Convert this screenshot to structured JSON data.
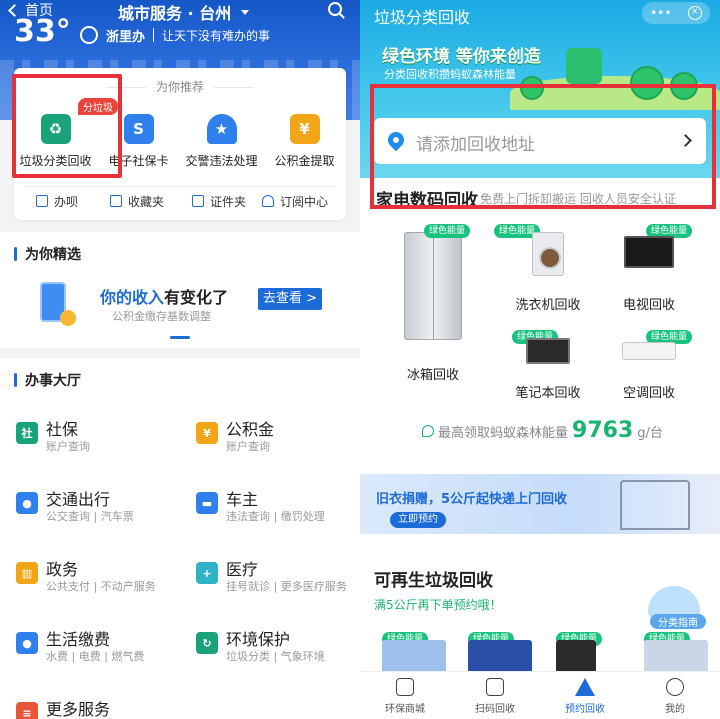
{
  "left": {
    "header": {
      "back_label": "首页",
      "title": "城市服务 · 台州",
      "temperature": "33°",
      "brand": "浙里办",
      "slogan": "让天下没有难办的事"
    },
    "recommend": {
      "title": "为你推荐",
      "badge": "分垃圾",
      "items": [
        {
          "label": "垃圾分类回收",
          "icon": "trash-bin-icon",
          "color": "#1aa37a"
        },
        {
          "label": "电子社保卡",
          "icon": "social-security-card-icon",
          "color": "#2f80ed"
        },
        {
          "label": "交警违法处理",
          "icon": "police-cap-icon",
          "color": "#2f80ed"
        },
        {
          "label": "公积金提取",
          "icon": "yuan-house-icon",
          "color": "#f2a516"
        }
      ],
      "tools": [
        {
          "label": "办呗",
          "icon": "ban-bei-icon"
        },
        {
          "label": "收藏夹",
          "icon": "folder-icon"
        },
        {
          "label": "证件夹",
          "icon": "id-card-icon"
        },
        {
          "label": "订阅中心",
          "icon": "bell-icon"
        }
      ]
    },
    "featured": {
      "heading": "为你精选",
      "title_highlight": "你的收入",
      "title_rest": "有变化了",
      "subtitle": "公积金缴存基数调整",
      "button": "去查看 >"
    },
    "hall": {
      "heading": "办事大厅",
      "items": [
        {
          "title": "社保",
          "sub": "账户查询",
          "icon": "shield-icon",
          "color": "#1aa37a",
          "glyph": "社"
        },
        {
          "title": "公积金",
          "sub": "账户查询",
          "icon": "yuan-house-icon",
          "color": "#f2a516",
          "glyph": "¥"
        },
        {
          "title": "交通出行",
          "sub": "公交查询 | 汽车票",
          "icon": "traffic-light-icon",
          "color": "#2f80ed",
          "glyph": "●"
        },
        {
          "title": "车主",
          "sub": "违法查询 | 缴罚处理",
          "icon": "car-icon",
          "color": "#2f80ed",
          "glyph": "▬"
        },
        {
          "title": "政务",
          "sub": "公共支付 | 不动产服务",
          "icon": "government-building-icon",
          "color": "#f2a516",
          "glyph": "▥"
        },
        {
          "title": "医疗",
          "sub": "挂号就诊 | 更多医疗服务",
          "icon": "medical-cross-icon",
          "color": "#2fb2c8",
          "glyph": "+"
        },
        {
          "title": "生活缴费",
          "sub": "水费 | 电费 | 燃气费",
          "icon": "water-drop-icon",
          "color": "#2f80ed",
          "glyph": "●"
        },
        {
          "title": "环境保护",
          "sub": "垃圾分类 | 气象环境",
          "icon": "recycle-icon",
          "color": "#1aa37a",
          "glyph": "↻"
        },
        {
          "title": "更多服务",
          "sub": "",
          "icon": "more-services-icon",
          "color": "#e8563a",
          "glyph": "≡"
        }
      ]
    }
  },
  "right": {
    "header": {
      "title": "垃圾分类回收",
      "more_label": "•••",
      "close_label": "×",
      "green_title": "绿色环境 等你来创造",
      "green_sub": "分类回收积攒蚂蚁森林能量"
    },
    "address": {
      "placeholder": "请添加回收地址"
    },
    "appliance": {
      "title": "家电数码回收",
      "subtitle": "免费上门拆卸搬运 回收人员安全认证",
      "tag": "绿色能量",
      "items": [
        {
          "label": "冰箱回收",
          "icon": "fridge-icon"
        },
        {
          "label": "洗衣机回收",
          "icon": "washing-machine-icon"
        },
        {
          "label": "电视回收",
          "icon": "tv-icon"
        },
        {
          "label": "笔记本回收",
          "icon": "laptop-icon"
        },
        {
          "label": "空调回收",
          "icon": "air-conditioner-icon"
        }
      ],
      "energy_prefix": "最高领取蚂蚁森林能量",
      "energy_value": "9763",
      "energy_unit": "g/台"
    },
    "banner": {
      "text": "旧衣捐赠，5公斤起快递上门回收",
      "button": "立即预约"
    },
    "recyclable": {
      "title": "可再生垃圾回收",
      "subtitle": "满5公斤再下单预约哦！",
      "guide": "分类指南",
      "tag": "绿色能量"
    },
    "tabs": [
      {
        "label": "环保商城",
        "icon": "shopping-bag-icon",
        "active": false
      },
      {
        "label": "扫码回收",
        "icon": "scan-icon",
        "active": false
      },
      {
        "label": "预约回收",
        "icon": "recycle-triangle-icon",
        "active": true
      },
      {
        "label": "我的",
        "icon": "user-icon",
        "active": false
      }
    ]
  }
}
